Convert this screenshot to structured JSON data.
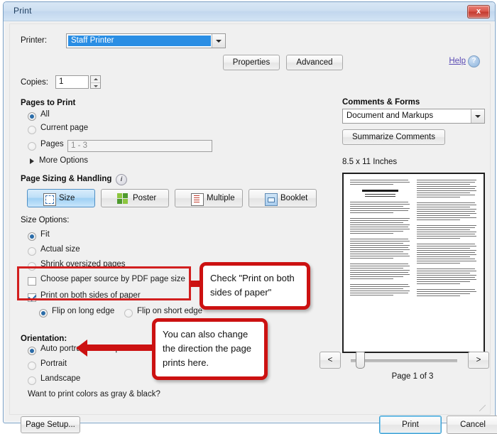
{
  "window": {
    "title": "Print",
    "close_label": "x"
  },
  "printer": {
    "label": "Printer:",
    "value": "Staff Printer",
    "properties_label": "Properties",
    "advanced_label": "Advanced",
    "help_label": "Help",
    "help_icon_glyph": "?"
  },
  "copies": {
    "label": "Copies:",
    "value": "1"
  },
  "pages_to_print": {
    "heading": "Pages to Print",
    "options": [
      {
        "label": "All",
        "selected": true
      },
      {
        "label": "Current page",
        "selected": false
      },
      {
        "label": "Pages",
        "selected": false
      }
    ],
    "pages_range_value": "1 - 3",
    "more_options_label": "More Options"
  },
  "page_sizing": {
    "heading": "Page Sizing & Handling",
    "info_icon_glyph": "i",
    "mode_buttons": [
      {
        "label": "Size",
        "icon": "size-icon",
        "selected": true
      },
      {
        "label": "Poster",
        "icon": "poster-icon",
        "selected": false
      },
      {
        "label": "Multiple",
        "icon": "multiple-icon",
        "selected": false
      },
      {
        "label": "Booklet",
        "icon": "booklet-icon",
        "selected": false
      }
    ],
    "size_options_label": "Size Options:",
    "size_options": [
      {
        "label": "Fit",
        "selected": true
      },
      {
        "label": "Actual size",
        "selected": false
      },
      {
        "label": "Shrink oversized pages",
        "selected": false
      }
    ],
    "choose_paper_source_label": "Choose paper source by PDF page size",
    "choose_paper_source_checked": false,
    "both_sides_label": "Print on both sides of paper",
    "both_sides_checked": true,
    "flip_options": [
      {
        "label": "Flip on long edge",
        "selected": true
      },
      {
        "label": "Flip on short edge",
        "selected": false
      }
    ]
  },
  "orientation": {
    "heading": "Orientation:",
    "options": [
      {
        "label": "Auto portrait/landscape",
        "selected": true
      },
      {
        "label": "Portrait",
        "selected": false
      },
      {
        "label": "Landscape",
        "selected": false
      }
    ],
    "gray_black_link": "Want to print colors as gray & black?"
  },
  "comments_forms": {
    "heading": "Comments & Forms",
    "selected_value": "Document and Markups",
    "summarize_label": "Summarize Comments"
  },
  "preview": {
    "paper_size": "8.5 x 11 Inches",
    "prev_label": "<",
    "next_label": ">",
    "page_indicator": "Page 1 of 3"
  },
  "footer": {
    "page_setup_label": "Page Setup...",
    "print_label": "Print",
    "cancel_label": "Cancel"
  },
  "annotations": [
    {
      "text": "Check \"Print on both sides of paper\""
    },
    {
      "text": "You can also change the direction the page prints here."
    }
  ],
  "colors": {
    "annotation_red": "#cc1111",
    "accent_blue": "#2a8ee4",
    "title_bar": "#cddff1",
    "selected_button": "#9fd0f4"
  }
}
